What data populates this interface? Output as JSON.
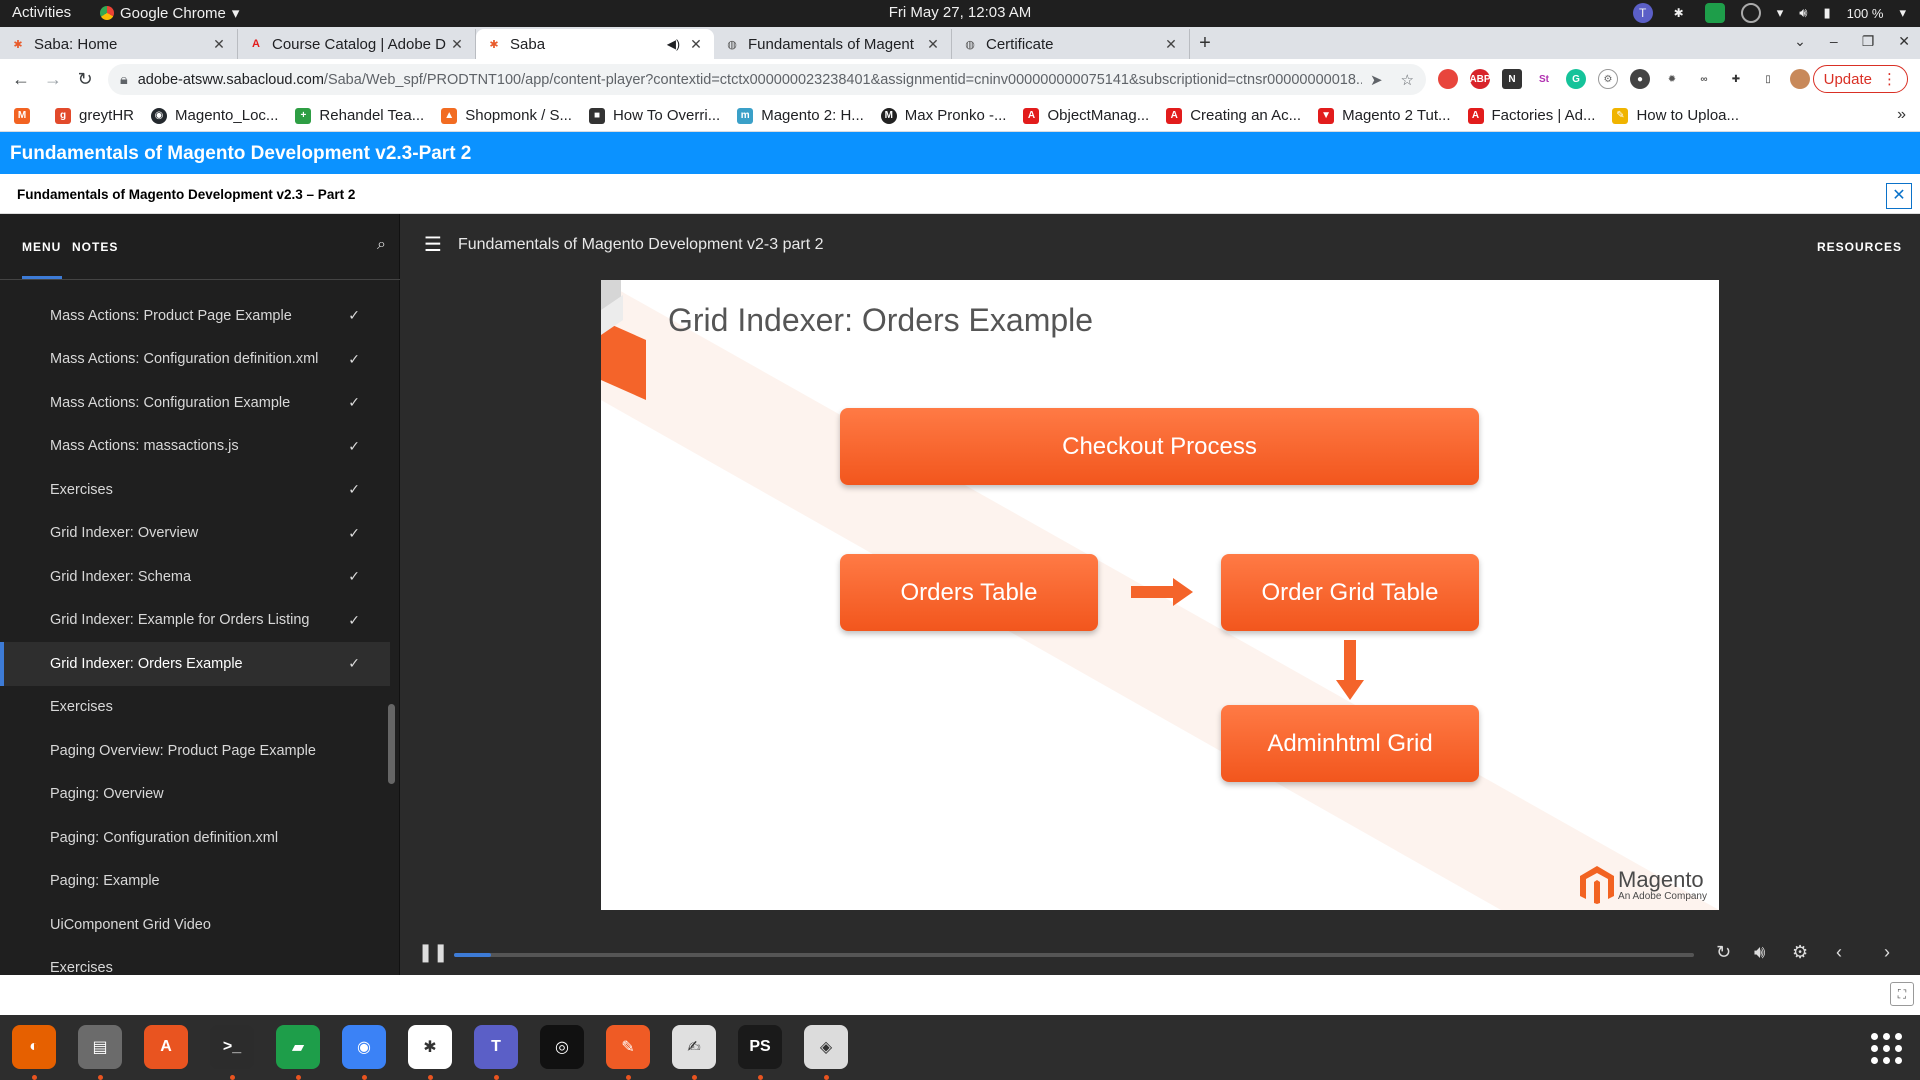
{
  "topbar": {
    "activities": "Activities",
    "app_name": "Google Chrome",
    "clock": "Fri May 27, 12:03 AM",
    "battery": "100 %"
  },
  "tabs": [
    {
      "title": "Saba: Home",
      "icon": "saba-icon"
    },
    {
      "title": "Course Catalog | Adobe D",
      "icon": "adobe-icon"
    },
    {
      "title": "Saba",
      "icon": "saba-icon",
      "active": true
    },
    {
      "title": "Fundamentals of Magent",
      "icon": "globe-icon"
    },
    {
      "title": "Certificate",
      "icon": "globe-icon"
    }
  ],
  "address": {
    "host": "adobe-atsww.sabacloud.com",
    "path": "/Saba/Web_spf/PRODTNT100/app/content-player?contextid=ctctx000000023238401&assignmentid=cninv000000000075141&subscriptionid=ctnsr00000000018..."
  },
  "update_label": "Update",
  "bookmarks": [
    {
      "label": "greytHR",
      "color": "#e24a2b"
    },
    {
      "label": "Magento_Loc...",
      "color": "#24292e"
    },
    {
      "label": "Rehandel Tea...",
      "color": "#2e9e44"
    },
    {
      "label": "Shopmonk / S...",
      "color": "#f26c22"
    },
    {
      "label": "How To Overri...",
      "color": "#333333"
    },
    {
      "label": "Magento 2: H...",
      "color": "#3aa0c8"
    },
    {
      "label": "Max Pronko -...",
      "color": "#222222"
    },
    {
      "label": "ObjectManag...",
      "color": "#e21c1c"
    },
    {
      "label": "Creating an Ac...",
      "color": "#e21c1c"
    },
    {
      "label": "Magento 2 Tut...",
      "color": "#e21c1c"
    },
    {
      "label": "Factories | Ad...",
      "color": "#e21c1c"
    },
    {
      "label": "How to Uploa...",
      "color": "#f0b400"
    }
  ],
  "saba": {
    "header_title": "Fundamentals of Magento Development v2.3-Part 2",
    "sub_title": "Fundamentals of Magento Development v2.3 – Part 2",
    "close": "✕"
  },
  "sidebar": {
    "menu_tab": "MENU",
    "notes_tab": "NOTES",
    "items": [
      {
        "label": "Mass Actions: Product Page Example",
        "done": true
      },
      {
        "label": "Mass Actions: Configuration definition.xml",
        "done": true
      },
      {
        "label": "Mass Actions: Configuration Example",
        "done": true
      },
      {
        "label": "Mass Actions: massactions.js",
        "done": true
      },
      {
        "label": "Exercises",
        "done": true
      },
      {
        "label": "Grid Indexer: Overview",
        "done": true
      },
      {
        "label": "Grid Indexer: Schema",
        "done": true
      },
      {
        "label": "Grid Indexer: Example for Orders Listing",
        "done": true
      },
      {
        "label": "Grid Indexer: Orders Example",
        "done": true,
        "active": true
      },
      {
        "label": "Exercises",
        "done": false
      },
      {
        "label": "Paging Overview: Product Page Example",
        "done": false
      },
      {
        "label": "Paging: Overview",
        "done": false
      },
      {
        "label": "Paging: Configuration definition.xml",
        "done": false
      },
      {
        "label": "Paging: Example",
        "done": false
      },
      {
        "label": "UiComponent Grid Video",
        "done": false
      },
      {
        "label": "Exercises",
        "done": false
      }
    ]
  },
  "stage": {
    "title": "Fundamentals of Magento Development v2-3 part 2",
    "resources": "RESOURCES",
    "progress": 0.03
  },
  "slide": {
    "title": "Grid Indexer: Orders Example",
    "boxes": {
      "checkout": "Checkout Process",
      "orders": "Orders Table",
      "order_grid": "Order Grid Table",
      "adminhtml": "Adminhtml Grid"
    },
    "logo_text": "Magento",
    "logo_sub": "An Adobe Company"
  },
  "dock": [
    {
      "name": "firefox",
      "color": "#e66000"
    },
    {
      "name": "files",
      "color": "#6b6b6b"
    },
    {
      "name": "software",
      "color": "#e95420"
    },
    {
      "name": "terminal",
      "color": "#2c2c2c"
    },
    {
      "name": "chat",
      "color": "#1e9e4a"
    },
    {
      "name": "chrome",
      "color": "#3b82f6"
    },
    {
      "name": "slack",
      "color": "#ffffff"
    },
    {
      "name": "teams",
      "color": "#5b5fc7"
    },
    {
      "name": "camera",
      "color": "#111111"
    },
    {
      "name": "postman",
      "color": "#ef5b25"
    },
    {
      "name": "text-editor",
      "color": "#e0e0e0"
    },
    {
      "name": "phpstorm",
      "color": "#1a1a1a"
    },
    {
      "name": "image-viewer",
      "color": "#dcdcdc"
    }
  ]
}
